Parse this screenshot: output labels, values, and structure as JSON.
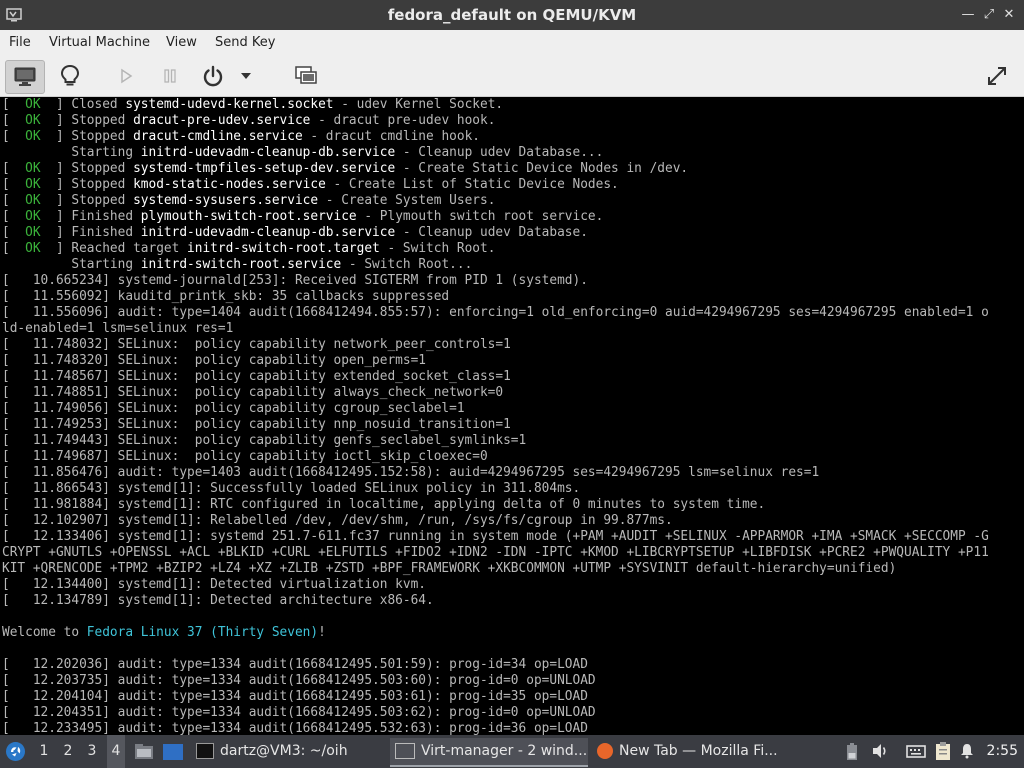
{
  "window": {
    "title": "fedora_default on QEMU/KVM"
  },
  "menu": [
    "File",
    "Virtual Machine",
    "View",
    "Send Key"
  ],
  "console_lines": [
    [
      {
        "t": "[  "
      },
      {
        "t": "OK",
        "c": "ok"
      },
      {
        "t": "  ] Closed "
      },
      {
        "t": "systemd-udevd-kernel.socket",
        "c": "hl"
      },
      {
        "t": " - udev Kernel Socket."
      }
    ],
    [
      {
        "t": "[  "
      },
      {
        "t": "OK",
        "c": "ok"
      },
      {
        "t": "  ] Stopped "
      },
      {
        "t": "dracut-pre-udev.service",
        "c": "hl"
      },
      {
        "t": " - dracut pre-udev hook."
      }
    ],
    [
      {
        "t": "[  "
      },
      {
        "t": "OK",
        "c": "ok"
      },
      {
        "t": "  ] Stopped "
      },
      {
        "t": "dracut-cmdline.service",
        "c": "hl"
      },
      {
        "t": " - dracut cmdline hook."
      }
    ],
    [
      {
        "t": "         Starting "
      },
      {
        "t": "initrd-udevadm-cleanup-db.service",
        "c": "hl"
      },
      {
        "t": " - Cleanup udev Database..."
      }
    ],
    [
      {
        "t": "[  "
      },
      {
        "t": "OK",
        "c": "ok"
      },
      {
        "t": "  ] Stopped "
      },
      {
        "t": "systemd-tmpfiles-setup-dev.service",
        "c": "hl"
      },
      {
        "t": " - Create Static Device Nodes in /dev."
      }
    ],
    [
      {
        "t": "[  "
      },
      {
        "t": "OK",
        "c": "ok"
      },
      {
        "t": "  ] Stopped "
      },
      {
        "t": "kmod-static-nodes.service",
        "c": "hl"
      },
      {
        "t": " - Create List of Static Device Nodes."
      }
    ],
    [
      {
        "t": "[  "
      },
      {
        "t": "OK",
        "c": "ok"
      },
      {
        "t": "  ] Stopped "
      },
      {
        "t": "systemd-sysusers.service",
        "c": "hl"
      },
      {
        "t": " - Create System Users."
      }
    ],
    [
      {
        "t": "[  "
      },
      {
        "t": "OK",
        "c": "ok"
      },
      {
        "t": "  ] Finished "
      },
      {
        "t": "plymouth-switch-root.service",
        "c": "hl"
      },
      {
        "t": " - Plymouth switch root service."
      }
    ],
    [
      {
        "t": "[  "
      },
      {
        "t": "OK",
        "c": "ok"
      },
      {
        "t": "  ] Finished "
      },
      {
        "t": "initrd-udevadm-cleanup-db.service",
        "c": "hl"
      },
      {
        "t": " - Cleanup udev Database."
      }
    ],
    [
      {
        "t": "[  "
      },
      {
        "t": "OK",
        "c": "ok"
      },
      {
        "t": "  ] Reached target "
      },
      {
        "t": "initrd-switch-root.target",
        "c": "hl"
      },
      {
        "t": " - Switch Root."
      }
    ],
    [
      {
        "t": "         Starting "
      },
      {
        "t": "initrd-switch-root.service",
        "c": "hl"
      },
      {
        "t": " - Switch Root..."
      }
    ],
    [
      {
        "t": "[   10.665234] systemd-journald[253]: Received SIGTERM from PID 1 (systemd)."
      }
    ],
    [
      {
        "t": "[   11.556092] kauditd_printk_skb: 35 callbacks suppressed"
      }
    ],
    [
      {
        "t": "[   11.556096] audit: type=1404 audit(1668412494.855:57): enforcing=1 old_enforcing=0 auid=4294967295 ses=4294967295 enabled=1 o"
      }
    ],
    [
      {
        "t": "ld-enabled=1 lsm=selinux res=1"
      }
    ],
    [
      {
        "t": "[   11.748032] SELinux:  policy capability network_peer_controls=1"
      }
    ],
    [
      {
        "t": "[   11.748320] SELinux:  policy capability open_perms=1"
      }
    ],
    [
      {
        "t": "[   11.748567] SELinux:  policy capability extended_socket_class=1"
      }
    ],
    [
      {
        "t": "[   11.748851] SELinux:  policy capability always_check_network=0"
      }
    ],
    [
      {
        "t": "[   11.749056] SELinux:  policy capability cgroup_seclabel=1"
      }
    ],
    [
      {
        "t": "[   11.749253] SELinux:  policy capability nnp_nosuid_transition=1"
      }
    ],
    [
      {
        "t": "[   11.749443] SELinux:  policy capability genfs_seclabel_symlinks=1"
      }
    ],
    [
      {
        "t": "[   11.749687] SELinux:  policy capability ioctl_skip_cloexec=0"
      }
    ],
    [
      {
        "t": "[   11.856476] audit: type=1403 audit(1668412495.152:58): auid=4294967295 ses=4294967295 lsm=selinux res=1"
      }
    ],
    [
      {
        "t": "[   11.866543] systemd[1]: Successfully loaded SELinux policy in 311.804ms."
      }
    ],
    [
      {
        "t": "[   11.981884] systemd[1]: RTC configured in localtime, applying delta of 0 minutes to system time."
      }
    ],
    [
      {
        "t": "[   12.102907] systemd[1]: Relabelled /dev, /dev/shm, /run, /sys/fs/cgroup in 99.877ms."
      }
    ],
    [
      {
        "t": "[   12.133406] systemd[1]: systemd 251.7-611.fc37 running in system mode (+PAM +AUDIT +SELINUX -APPARMOR +IMA +SMACK +SECCOMP -G"
      }
    ],
    [
      {
        "t": "CRYPT +GNUTLS +OPENSSL +ACL +BLKID +CURL +ELFUTILS +FIDO2 +IDN2 -IDN -IPTC +KMOD +LIBCRYPTSETUP +LIBFDISK +PCRE2 +PWQUALITY +P11"
      }
    ],
    [
      {
        "t": "KIT +QRENCODE +TPM2 +BZIP2 +LZ4 +XZ +ZLIB +ZSTD +BPF_FRAMEWORK +XKBCOMMON +UTMP +SYSVINIT default-hierarchy=unified)"
      }
    ],
    [
      {
        "t": "[   12.134400] systemd[1]: Detected virtualization kvm."
      }
    ],
    [
      {
        "t": "[   12.134789] systemd[1]: Detected architecture x86-64."
      }
    ],
    [
      {
        "t": ""
      }
    ],
    [
      {
        "t": "Welcome to "
      },
      {
        "t": "Fedora Linux 37 (Thirty Seven)",
        "c": "blue"
      },
      {
        "t": "!"
      }
    ],
    [
      {
        "t": ""
      }
    ],
    [
      {
        "t": "[   12.202036] audit: type=1334 audit(1668412495.501:59): prog-id=34 op=LOAD"
      }
    ],
    [
      {
        "t": "[   12.203735] audit: type=1334 audit(1668412495.503:60): prog-id=0 op=UNLOAD"
      }
    ],
    [
      {
        "t": "[   12.204104] audit: type=1334 audit(1668412495.503:61): prog-id=35 op=LOAD"
      }
    ],
    [
      {
        "t": "[   12.204351] audit: type=1334 audit(1668412495.503:62): prog-id=0 op=UNLOAD"
      }
    ],
    [
      {
        "t": "[   12.233495] audit: type=1334 audit(1668412495.532:63): prog-id=36 op=LOAD"
      }
    ]
  ],
  "taskbar": {
    "workspaces": [
      "1",
      "2",
      "3",
      "4"
    ],
    "tasks": {
      "terminal": "dartz@VM3: ~/oih",
      "virt_manager": "Virt-manager - 2 wind...",
      "firefox": "New Tab — Mozilla Fi..."
    },
    "clock": "2:55"
  }
}
